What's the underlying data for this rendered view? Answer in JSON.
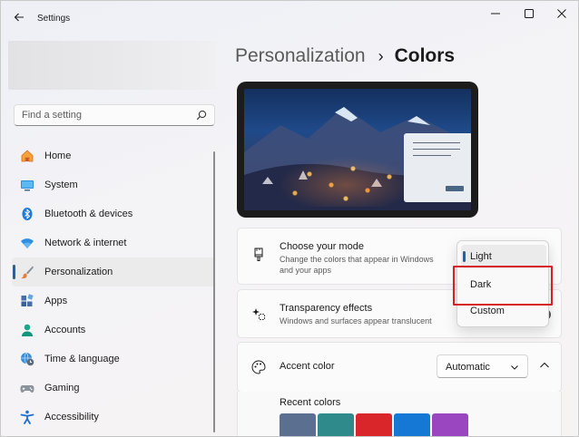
{
  "window": {
    "title": "Settings",
    "controls": [
      "minimize",
      "maximize",
      "close"
    ]
  },
  "search": {
    "placeholder": "Find a setting"
  },
  "sidebar": {
    "items": [
      {
        "label": "Home",
        "icon": "home-icon"
      },
      {
        "label": "System",
        "icon": "monitor-icon"
      },
      {
        "label": "Bluetooth & devices",
        "icon": "bluetooth-icon"
      },
      {
        "label": "Network & internet",
        "icon": "wifi-icon"
      },
      {
        "label": "Personalization",
        "icon": "brush-icon",
        "active": true
      },
      {
        "label": "Apps",
        "icon": "apps-icon"
      },
      {
        "label": "Accounts",
        "icon": "person-icon"
      },
      {
        "label": "Time & language",
        "icon": "globe-clock-icon"
      },
      {
        "label": "Gaming",
        "icon": "gamepad-icon"
      },
      {
        "label": "Accessibility",
        "icon": "accessibility-icon"
      }
    ]
  },
  "breadcrumb": {
    "parent": "Personalization",
    "separator": "›",
    "current": "Colors"
  },
  "mode_card": {
    "title": "Choose your mode",
    "description": "Change the colors that appear in Windows and your apps"
  },
  "transparency_card": {
    "title": "Transparency effects",
    "description": "Windows and surfaces appear translucent"
  },
  "accent_card": {
    "title": "Accent color",
    "selected": "Automatic"
  },
  "recent_colors": {
    "label": "Recent colors",
    "swatches": [
      "#5b7091",
      "#2f8a8c",
      "#d9262a",
      "#1478d4",
      "#9a46c1"
    ]
  },
  "mode_dropdown": {
    "options": [
      "Light",
      "Dark",
      "Custom"
    ],
    "selected": "Light",
    "highlighted": "Dark"
  },
  "colors": {
    "accent": "#2f5f8a",
    "highlight_box": "#d61f26"
  }
}
